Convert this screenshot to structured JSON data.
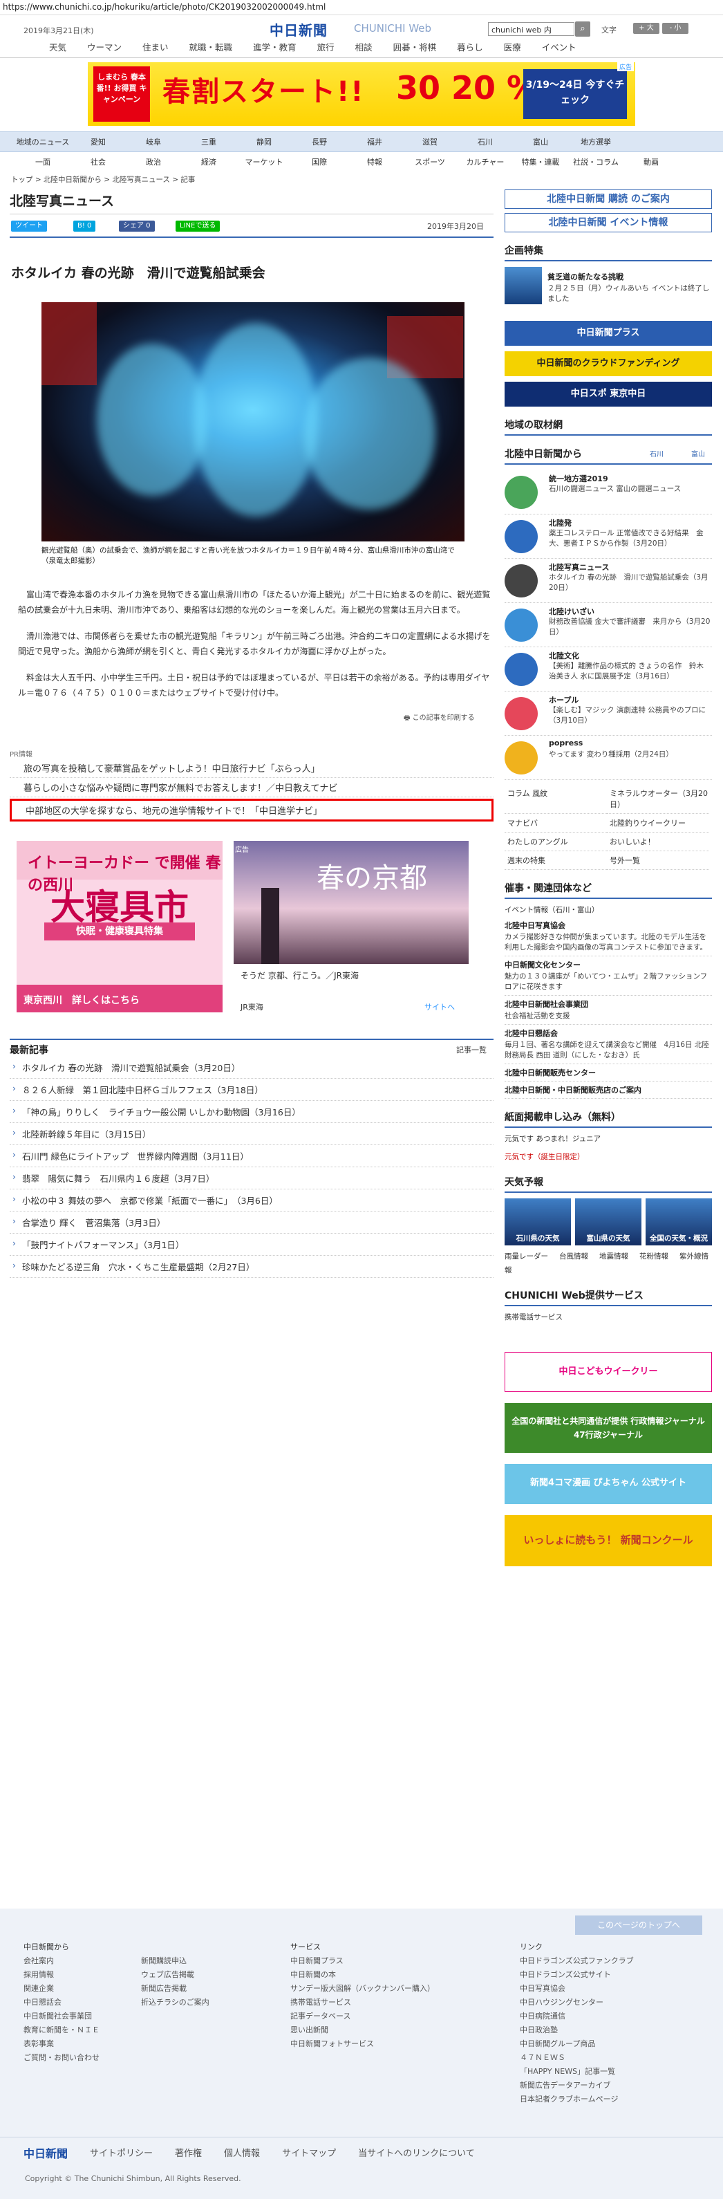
{
  "url": "https://www.chunichi.co.jp/hokuriku/article/photo/CK2019032002000049.html",
  "header": {
    "date": "2019年3月21日(木)",
    "logo": "中日新聞",
    "logo_sub": "CHUNICHI Web",
    "search_placeholder": "chunichi web 内",
    "font_size_label": "文字",
    "font_large": "+ 大",
    "font_small": "- 小"
  },
  "global_nav": [
    "天気",
    "ウーマン",
    "住まい",
    "就職・転職",
    "進学・教育",
    "旅行",
    "相談",
    "囲碁・将棋",
    "暮らし",
    "医療",
    "イベント"
  ],
  "ad_banner": {
    "badge": "しまむら 春本番!! お得買 キャンペーン",
    "headline": "春割スタート!!",
    "discount": "30 20 %OFF",
    "cta": "3/19〜24日 今すぐチェック",
    "ad_tag": "広告"
  },
  "section_nav": {
    "row1": [
      "地域のニュース",
      "愛知",
      "岐阜",
      "三重",
      "静岡",
      "長野",
      "福井",
      "滋賀",
      "石川",
      "富山",
      "地方選挙"
    ],
    "row2": [
      "一面",
      "社会",
      "政治",
      "経済",
      "マーケット",
      "国際",
      "特報",
      "スポーツ",
      "カルチャー",
      "特集・連載",
      "社説・コラム",
      "動画"
    ]
  },
  "breadcrumb": "トップ > 北陸中日新聞から > 北陸写真ニュース > 記事",
  "page_title": "北陸写真ニュース",
  "social": {
    "tweet": "ツイート",
    "hatena": "B! 0",
    "share": "シェア 0",
    "line": "LINEで送る",
    "date": "2019年3月20日"
  },
  "article": {
    "title": "ホタルイカ 春の光跡　滑川で遊覧船試乗会",
    "caption": "観光遊覧船（奥）の試乗会で、漁師が網を起こすと青い光を放つホタルイカ＝１９日午前４時４分、富山県滑川市沖の富山湾で（泉竜太郎撮影）",
    "paragraphs": [
      "富山湾で春漁本番のホタルイカ漁を見物できる富山県滑川市の「ほたるいか海上観光」が二十日に始まるのを前に、観光遊覧船の試乗会が十九日未明、滑川市沖であり、乗船客は幻想的な光のショーを楽しんだ。海上観光の営業は五月六日まで。",
      "滑川漁港では、市関係者らを乗せた市の観光遊覧船「キラリン」が午前三時ごろ出港。沖合約二キロの定置網による水揚げを間近で見守った。漁船から漁師が網を引くと、青白く発光するホタルイカが海面に浮かび上がった。",
      "料金は大人五千円、小中学生三千円。土日・祝日は予約ではぼ埋まっているが、平日は若干の余裕がある。予約は専用ダイヤル＝電０７６（４７５）０１００＝またはウェブサイトで受け付け中。"
    ],
    "print_label": "この記事を印刷する"
  },
  "pr": {
    "label": "PR情報",
    "items": [
      "旅の写真を投稿して豪華賞品をゲットしよう！中日旅行ナビ「ぶらっ人」",
      "暮らしの小さな悩みや疑問に専門家が無料でお答えします！／中日教えてナビ",
      "中部地区の大学を探すなら、地元の進学情報サイトで！「中日進学ナビ」"
    ]
  },
  "ads": {
    "ad1_header": "イトーヨーカドー で開催 春の西川",
    "ad1_big": "大寝具市",
    "ad1_sub": "快眠・健康寝具特集",
    "ad1_footer": "東京西川　詳しくはこちら",
    "ad2_tag": "広告",
    "ad2_title": "春の京都",
    "ad2_caption": "そうだ 京都、行こう。／JR東海",
    "ad2_source": "JR東海",
    "ad2_link": "サイトへ"
  },
  "latest": {
    "title": "最新記事",
    "more": "記事一覧",
    "items": [
      "ホタルイカ 春の光跡　滑川で遊覧船試乗会（3月20日）",
      "８２６人新緑　第１回北陸中日杯Ｇゴルフフェス（3月18日）",
      "「神の鳥」りりしく　ライチョウ一般公開 いしかわ動物園（3月16日）",
      "北陸新幹線５年目に（3月15日）",
      "石川門 緑色にライトアップ　世界緑内障週間（3月11日）",
      "翡翠　陽気に舞う　石川県内１６度超（3月7日）",
      "小松の中３ 舞妓の夢へ　京都で修業「紙面で一番に」　（3月6日）",
      "合掌造り 輝く　菅沼集落（3月3日）",
      "「鼓門ナイトパフォーマンス」（3月1日）",
      "珍味かたどる逆三角　穴水・くちこ生産最盛期（2月27日）"
    ]
  },
  "sidebar": {
    "subscribe": "北陸中日新聞 購読 のご案内",
    "events": "北陸中日新聞 イベント情報",
    "kikaku_title": "企画特集",
    "kikaku_item_title": "貧乏道の新たなる挑戦",
    "kikaku_item_text": "２月２５日（月）ウィルあいち イベントは終了しました",
    "banner_plus": "中日新聞プラス",
    "banner_cf": "中日新聞のクラウドファンディング",
    "banner_sports": "中日スポ 東京中日",
    "local_title": "地域の取材網",
    "from_title": "北陸中日新聞から",
    "from_tabs": [
      "石川",
      "富山"
    ],
    "from_items": [
      {
        "title": "統一地方選2019",
        "text": "石川の闘選ニュース 富山の闘選ニュース",
        "color": "#4aa55a"
      },
      {
        "title": "北陸発",
        "text": "薬王コレステロール 正常値改できる好結果　金大、悪者ＩＰＳから作製（3月20日）",
        "color": "#2d6bbf"
      },
      {
        "title": "北陸写真ニュース",
        "text": "ホタルイカ 春の光跡　滑川で遊覧船試乗会（3月20日）",
        "color": "#444444"
      },
      {
        "title": "北陸けいざい",
        "text": "財務改善協議 金大で審評議審　来月から（3月20日）",
        "color": "#3a8fd6"
      },
      {
        "title": "北陸文化",
        "text": "【美術】離騰作品の様式的 きょうの名作　鈴木治美き人 氷に国展展予定（3月16日）",
        "color": "#2d6bbf"
      },
      {
        "title": "ホープル",
        "text": "【楽しむ】マジック 演劇連特 公務員やのプロに（3月10日）",
        "color": "#e5475a"
      },
      {
        "title": "popress",
        "text": "やってます 変わり種採用（2月24日）",
        "color": "#f0b21d"
      }
    ],
    "mini_links": [
      "コラム 風紋",
      "ミネラルウオーター（3月20日）",
      "マナビバ",
      "北陸釣りウイークリー",
      "わたしのアングル",
      "おいしいよ！",
      "週末の特集",
      "号外一覧"
    ],
    "events_title": "催事・関連団体など",
    "events_sub": "イベント情報（石川・富山）",
    "event_items": [
      {
        "title": "北陸中日写真協会",
        "text": "カメラ撮影好きな仲間が集まっています。北陸のモデル生活を利用した撮影会や国内画像の写真コンテストに参加できます。"
      },
      {
        "title": "中日新聞文化センター",
        "text": "魅力の１３０講座が「めいてつ・エムザ」２階ファッションフロアに花咲きます"
      },
      {
        "title": "北陸中日新聞社会事業団",
        "text": "社会福祉活動を支援"
      },
      {
        "title": "北陸中日懇話会",
        "text": "毎月１回、著名な講師を迎えて講演会など開催　4月16日 北陸財務局長 西田 道則（にした・なおき）氏"
      },
      {
        "title": "北陸中日新聞販売センター",
        "text": ""
      },
      {
        "title": "北陸中日新聞・中日新聞販売店のご案内",
        "text": ""
      }
    ],
    "apply_title": "紙面掲載申し込み（無料）",
    "apply_items": [
      "元気です あつまれ！ジュニア",
      "元気です（誕生日限定）"
    ],
    "weather_title": "天気予報",
    "weather_boxes": [
      "石川県の天気",
      "富山県の天気",
      "全国の天気・概況"
    ],
    "weather_links": [
      "雨量レーダー",
      "台風情報",
      "地震情報",
      "花粉情報",
      "紫外線情報"
    ],
    "service_title": "CHUNICHI Web提供サービス",
    "service_link": "携帯電話サービス",
    "bnr_kodomo": "中日こどもウイークリー",
    "bnr_47": "全国の新聞社と共同通信が提供 行政情報ジャーナル 47行政ジャーナル",
    "bnr_manga": "新聞4コマ漫画 ぴよちゃん 公式サイト",
    "bnr_nie": "いっしょに読もう！ 新聞コンクール"
  },
  "footer": {
    "to_top": "このページのトップへ",
    "col1": [
      "中日新聞から",
      "会社案内",
      "採用情報",
      "関連企業",
      "中日懇話会",
      "中日新聞社会事業団",
      "教育に新聞を・ＮＩＥ",
      "表彰事業",
      "ご質問・お問い合わせ"
    ],
    "col2": [
      "新聞購読申込",
      "ウェブ広告掲載",
      "新聞広告掲載",
      "折込チラシのご案内"
    ],
    "col3": [
      "サービス",
      "中日新聞プラス",
      "中日新聞の本",
      "サンデー版大図解（バックナンバー購入）",
      "携帯電話サービス",
      "記事データベース",
      "思い出新聞",
      "中日新聞フォトサービス"
    ],
    "col4": [
      "リンク",
      "中日ドラゴンズ公式ファンクラブ",
      "中日ドラゴンズ公式サイト",
      "中日写真協会",
      "中日ハウジングセンター",
      "中日病院通信",
      "中日政治塾",
      "中日新聞グループ商品",
      "４７ＮＥＷＳ",
      "「HAPPY NEWS」記事一覧",
      "新聞広告データアーカイブ",
      "日本記者クラブホームページ"
    ],
    "bar_logo": "中日新聞",
    "bar_links": [
      "サイトポリシー",
      "著作権",
      "個人情報",
      "サイトマップ",
      "当サイトへのリンクについて"
    ],
    "copyright": "Copyright © The Chunichi Shimbun, All Rights Reserved."
  }
}
